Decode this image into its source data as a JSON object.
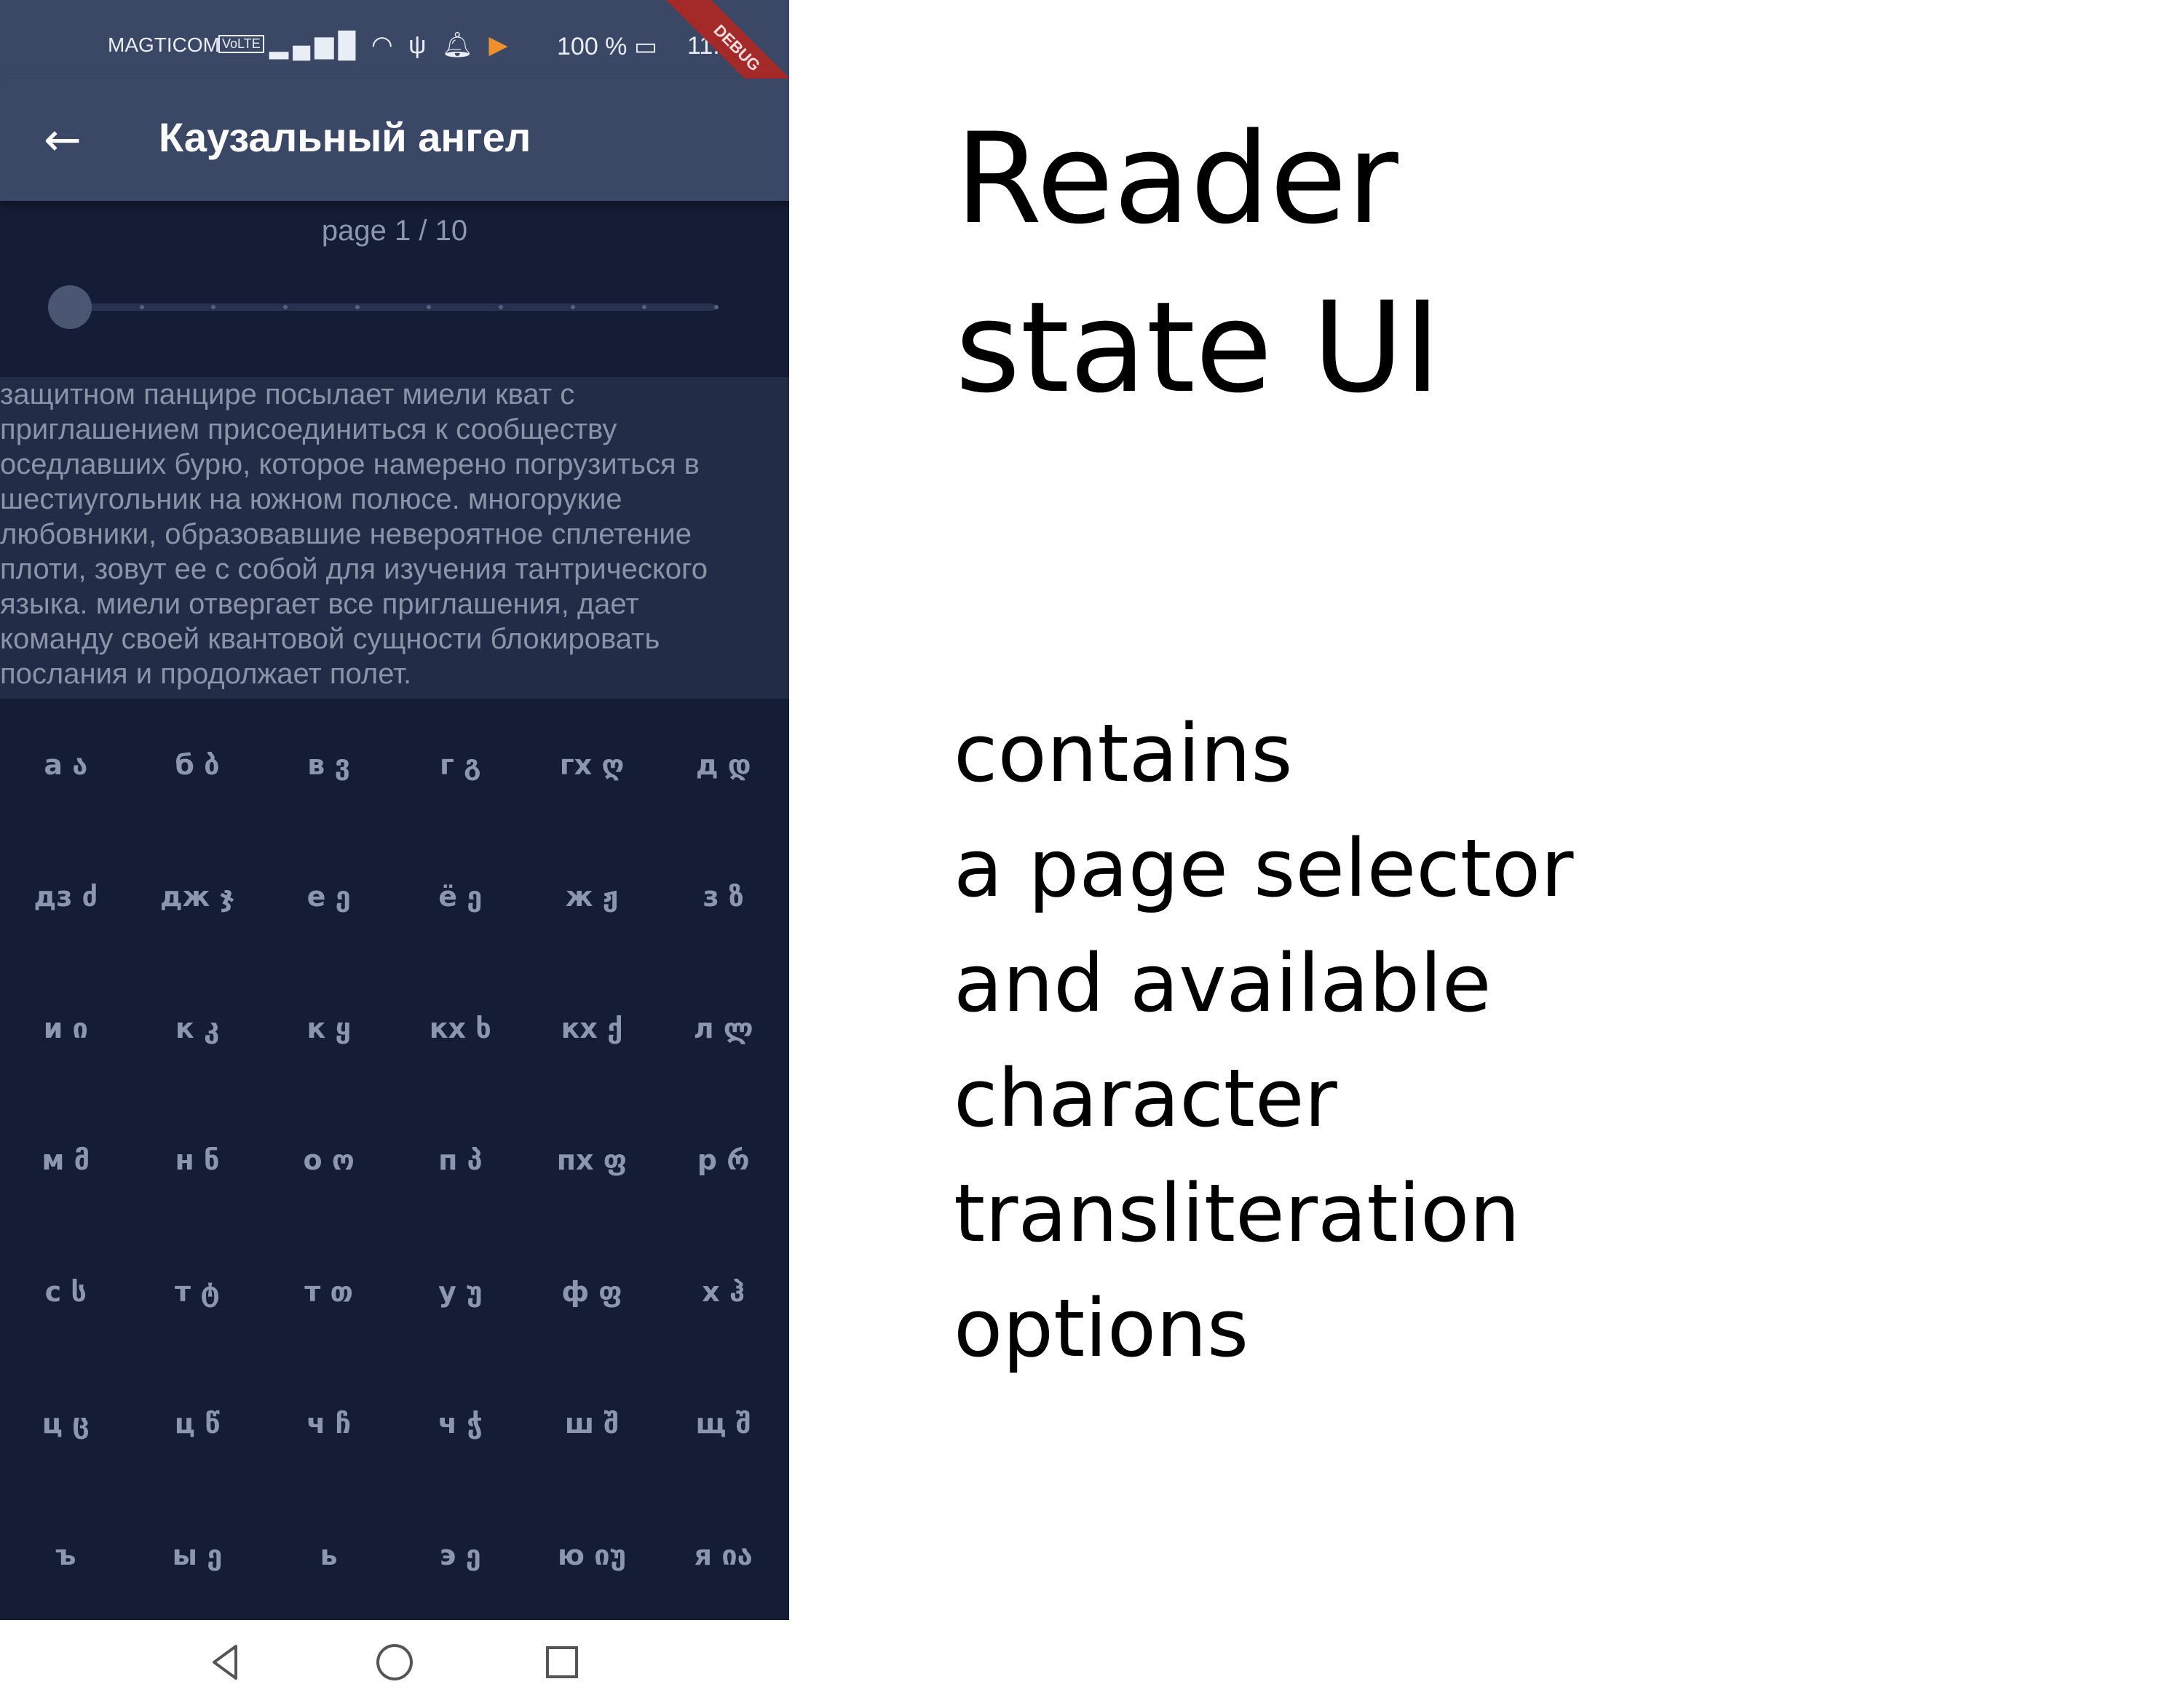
{
  "status_bar": {
    "carrier": "MAGTICOM",
    "volte": "VoLTE",
    "battery": "100 %",
    "time": "11:18",
    "debug_banner": "DEBUG"
  },
  "app_bar": {
    "title": "Каузальный ангел"
  },
  "page_selector": {
    "label": "page 1 / 10",
    "current_page": 1,
    "total_pages": 10
  },
  "text_panel": {
    "content": "защитном панцире посылает миели кват с\nприглашением присоединиться к сообществу\nоседлавших бурю, которое намерено погрузиться в\nшестиугольник на южном полюсе. многорукие\nлюбовники, образовавшие невероятное сплетение\nплоти, зовут ее с собой для изучения тантрического\nязыка. миели отвергает все приглашения, дает\nкоманду своей квантовой сущности блокировать\nпослания и продолжает полет."
  },
  "transliteration": [
    [
      "а ა",
      "б ბ",
      "в ვ",
      "г გ",
      "гх ღ",
      "д დ"
    ],
    [
      "дз ძ",
      "дж ჯ",
      "е ე",
      "ё ე",
      "ж ჟ",
      "з ზ"
    ],
    [
      "и ი",
      "к კ",
      "к ყ",
      "кх ხ",
      "кх ქ",
      "л ლ"
    ],
    [
      "м მ",
      "н ნ",
      "о ო",
      "п პ",
      "пх ფ",
      "р რ"
    ],
    [
      "с ს",
      "т ტ",
      "т თ",
      "у უ",
      "ф ფ",
      "х ჰ"
    ],
    [
      "ц ც",
      "ц წ",
      "ч ჩ",
      "ч ჭ",
      "ш შ",
      "щ შ"
    ],
    [
      "ъ",
      "ы ე",
      "ь",
      "э ე",
      "ю იუ",
      "я ია"
    ]
  ],
  "caption": {
    "heading": "Reader\nstate UI",
    "description": "contains\na page selector\nand available\ncharacter\ntransliteration\noptions"
  }
}
